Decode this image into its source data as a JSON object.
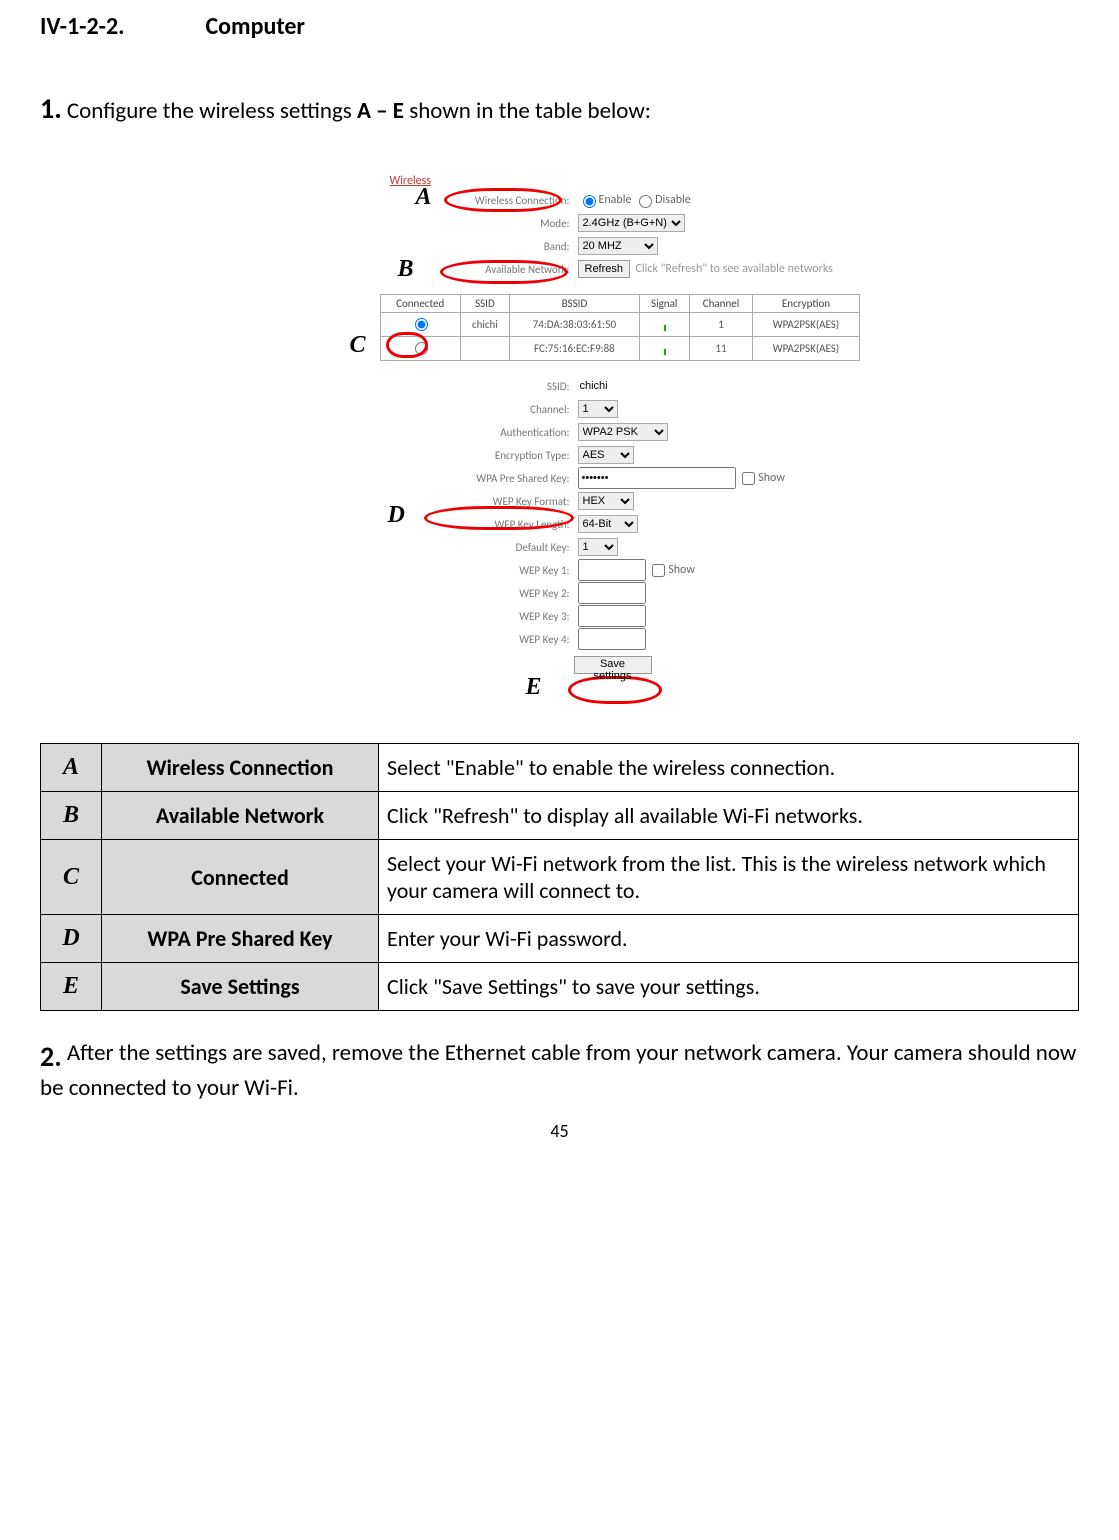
{
  "section_number": "IV-1-2-2.",
  "section_title": "Computer",
  "step1_num": "1.",
  "step1_pre": "Configure the wireless settings ",
  "step1_bold": "A – E",
  "step1_post": " shown in the table below:",
  "wireless_header": "Wireless",
  "callouts": {
    "A": "A",
    "B": "B",
    "C": "C",
    "D": "D",
    "E": "E"
  },
  "form": {
    "wc_label": "Wireless Connection:",
    "enable": "Enable",
    "disable": "Disable",
    "mode_label": "Mode:",
    "mode_value": "2.4GHz (B+G+N)",
    "band_label": "Band:",
    "band_value": "20 MHZ",
    "avail_label": "Available Network:",
    "refresh_btn": "Refresh",
    "refresh_hint": "Click \"Refresh\" to see available networks",
    "ssid_label": "SSID:",
    "ssid_value": "chichi",
    "channel_label": "Channel:",
    "channel_value": "1",
    "auth_label": "Authentication:",
    "auth_value": "WPA2 PSK",
    "enc_label": "Encryption Type:",
    "enc_value": "AES",
    "psk_label": "WPA Pre Shared Key:",
    "psk_value": "•••••••",
    "show": "Show",
    "wepfmt_label": "WEP Key Format:",
    "wepfmt_value": "HEX",
    "weplen_label": "WEP Key Length:",
    "weplen_value": "64-Bit",
    "defkey_label": "Default Key:",
    "defkey_value": "1",
    "wep1": "WEP Key 1:",
    "wep2": "WEP Key 2:",
    "wep3": "WEP Key 3:",
    "wep4": "WEP Key 4:",
    "save_btn": "Save settings"
  },
  "nettable": {
    "headers": [
      "Connected",
      "SSID",
      "BSSID",
      "Signal",
      "Channel",
      "Encryption"
    ],
    "rows": [
      {
        "ssid": "chichi",
        "bssid": "74:DA:38:03:61:50",
        "channel": "1",
        "enc": "WPA2PSK(AES)",
        "selected": true
      },
      {
        "ssid": "",
        "bssid": "FC:75:16:EC:F9:88",
        "channel": "11",
        "enc": "WPA2PSK(AES)",
        "selected": false
      }
    ]
  },
  "desc": [
    {
      "k": "A",
      "name": "Wireless Connection",
      "txt": "Select \"Enable\" to enable the wireless connection."
    },
    {
      "k": "B",
      "name": "Available Network",
      "txt": "Click \"Refresh\" to display all available Wi-Fi networks."
    },
    {
      "k": "C",
      "name": "Connected",
      "txt": "Select your Wi-Fi network from the list. This is the wireless network which your camera will connect to."
    },
    {
      "k": "D",
      "name": "WPA Pre Shared Key",
      "txt": "Enter your Wi-Fi password."
    },
    {
      "k": "E",
      "name": "Save Settings",
      "txt": "Click \"Save Settings\" to save your settings."
    }
  ],
  "step2_num": "2.",
  "step2_txt": "After the settings are saved, remove the Ethernet cable from your network camera. Your camera should now be connected to your Wi-Fi.",
  "page_number": "45"
}
